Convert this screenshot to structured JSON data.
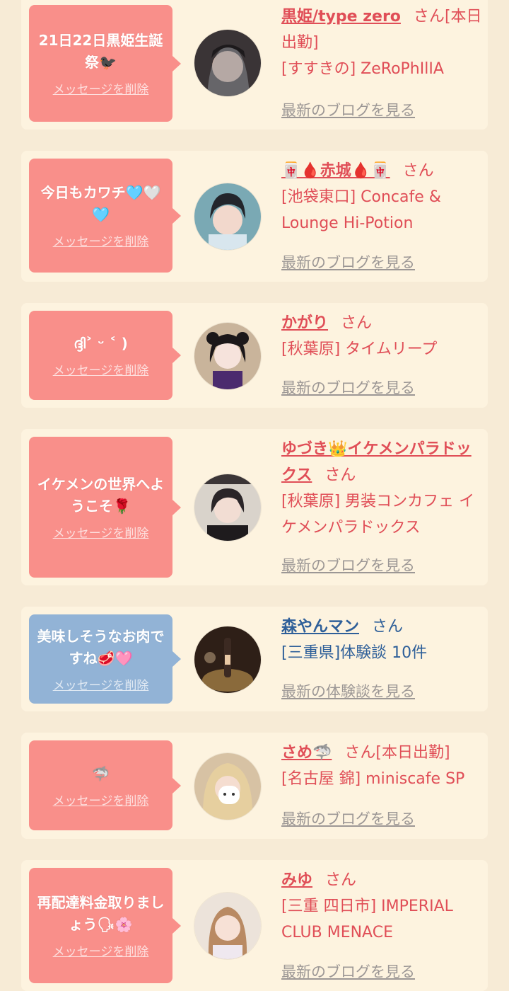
{
  "delete_label": "メッセージを削除",
  "san_label": "さん",
  "colors": {
    "page_bg": "#f7ebd6",
    "card_bg": "#fdf3df",
    "bubble_pink": "#f98f8a",
    "bubble_blue": "#92b3d6",
    "text_pink": "#e04e57",
    "text_blue": "#2e5f99",
    "link_gray": "#9c9795"
  },
  "items": [
    {
      "message": "21日22日黒姫生誕祭🐦‍⬛",
      "name": "黒姫/type zero",
      "suffix": "[本日出勤]",
      "detail": "[すすきの] ZeRoPhIlIA",
      "link": "最新のブログを見る"
    },
    {
      "message": "今日もカワチ🩵🤍🩵",
      "name": "🀄🩸赤城🩸🀄",
      "suffix": "",
      "detail": "[池袋東口] Concafe & Lounge Hi-Potion",
      "link": "最新のブログを見る"
    },
    {
      "message": "ദ്ദി˃ ᵕ ˂ )",
      "name": "かがり",
      "suffix": "",
      "detail": "[秋葉原] タイムリープ",
      "link": "最新のブログを見る"
    },
    {
      "message": "イケメンの世界へようこそ🌹",
      "name": "ゆづき👑イケメンパラドックス",
      "suffix": "",
      "detail": "[秋葉原] 男装コンカフェ イケメンパラドックス",
      "link": "最新のブログを見る"
    },
    {
      "message": "美味しそうなお肉ですね🥩🩷",
      "name": "森やんマン",
      "suffix": "",
      "detail": "[三重県]体験談 10件",
      "link": "最新の体験談を見る"
    },
    {
      "message": "🦈",
      "name": "さめ🦈",
      "suffix": "[本日出勤]",
      "detail": "[名古屋 錦] miniscafe SP",
      "link": "最新のブログを見る"
    },
    {
      "message": "再配達料金取りましょう🗣🌸",
      "name": "みゆ",
      "suffix": "",
      "detail": "[三重 四日市] IMPERIAL CLUB MENACE",
      "link": "最新のブログを見る"
    }
  ]
}
